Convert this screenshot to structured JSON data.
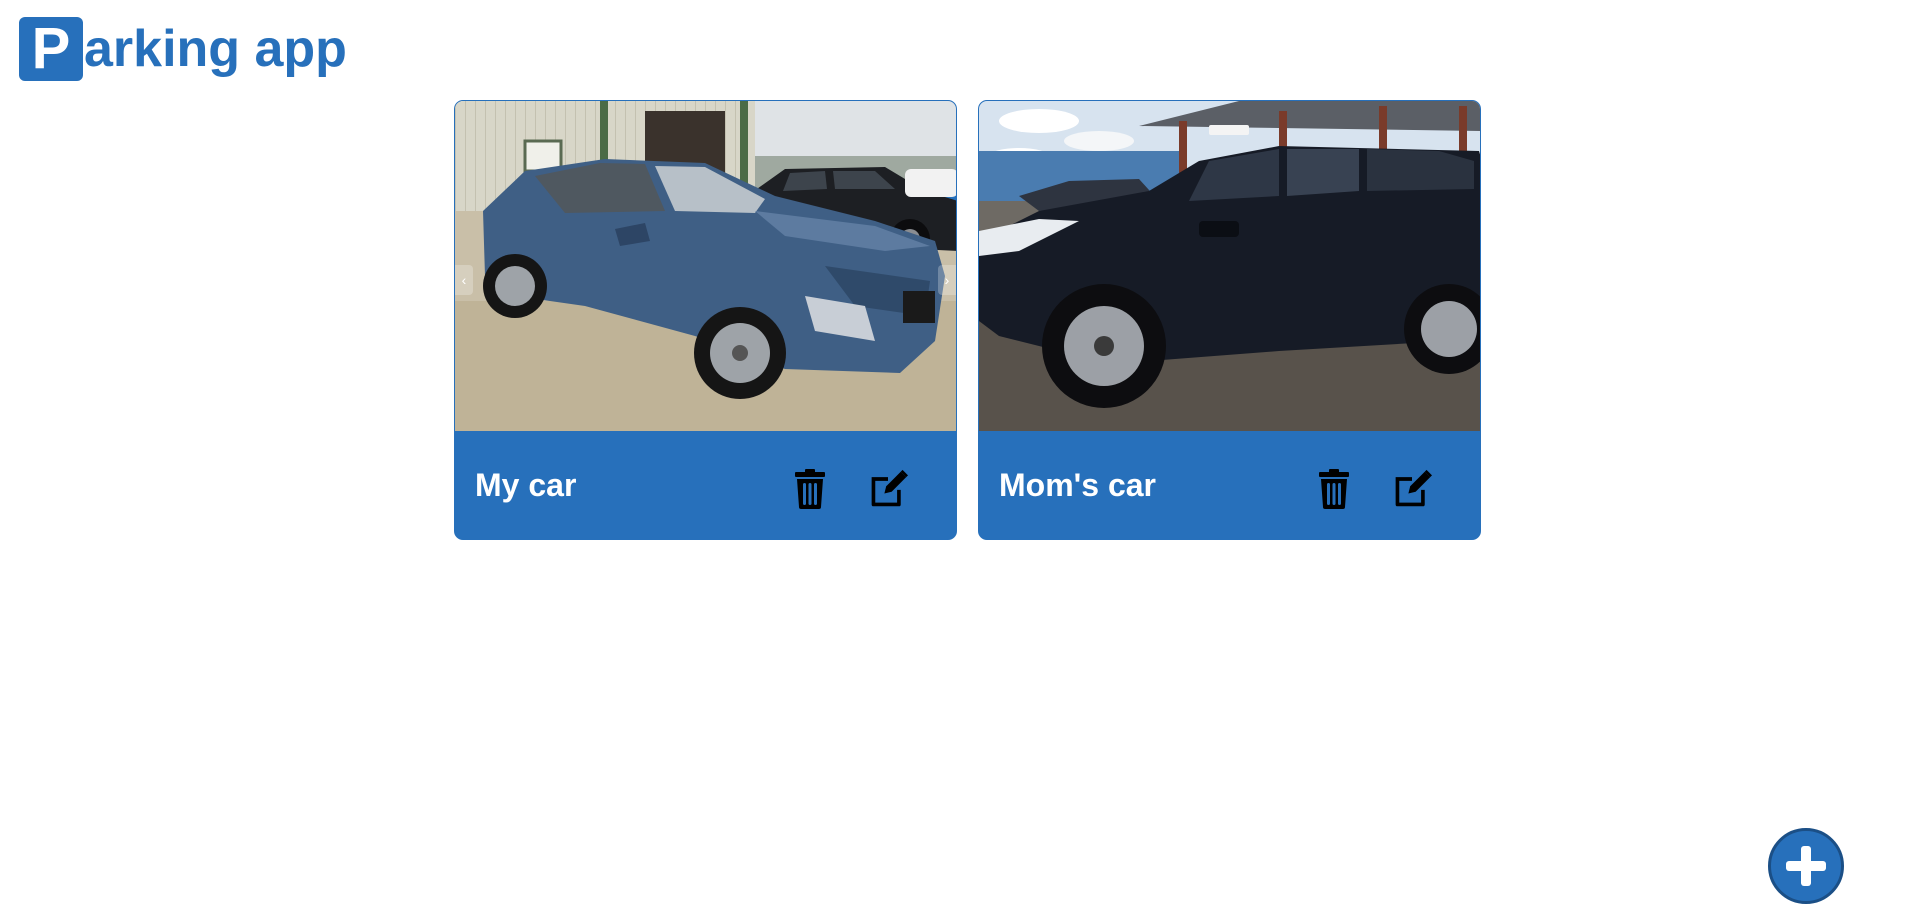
{
  "app": {
    "logo_letter": "P",
    "logo_rest": "arking app"
  },
  "colors": {
    "brand": "#2770bb",
    "text_on_brand": "#ffffff",
    "icon": "#000000"
  },
  "cars": [
    {
      "name": "My car",
      "photo": "blue compact SUV parked in a lot",
      "photo_icon": "car-photo-blue-suv",
      "prev_label": "‹",
      "next_label": "›",
      "delete_icon": "trash-icon",
      "edit_icon": "edit-icon"
    },
    {
      "name": "Mom's car",
      "photo": "dark compact SUV parked in a lot",
      "photo_icon": "car-photo-black-suv",
      "delete_icon": "trash-icon",
      "edit_icon": "edit-icon"
    }
  ],
  "fab": {
    "icon": "plus-icon"
  }
}
